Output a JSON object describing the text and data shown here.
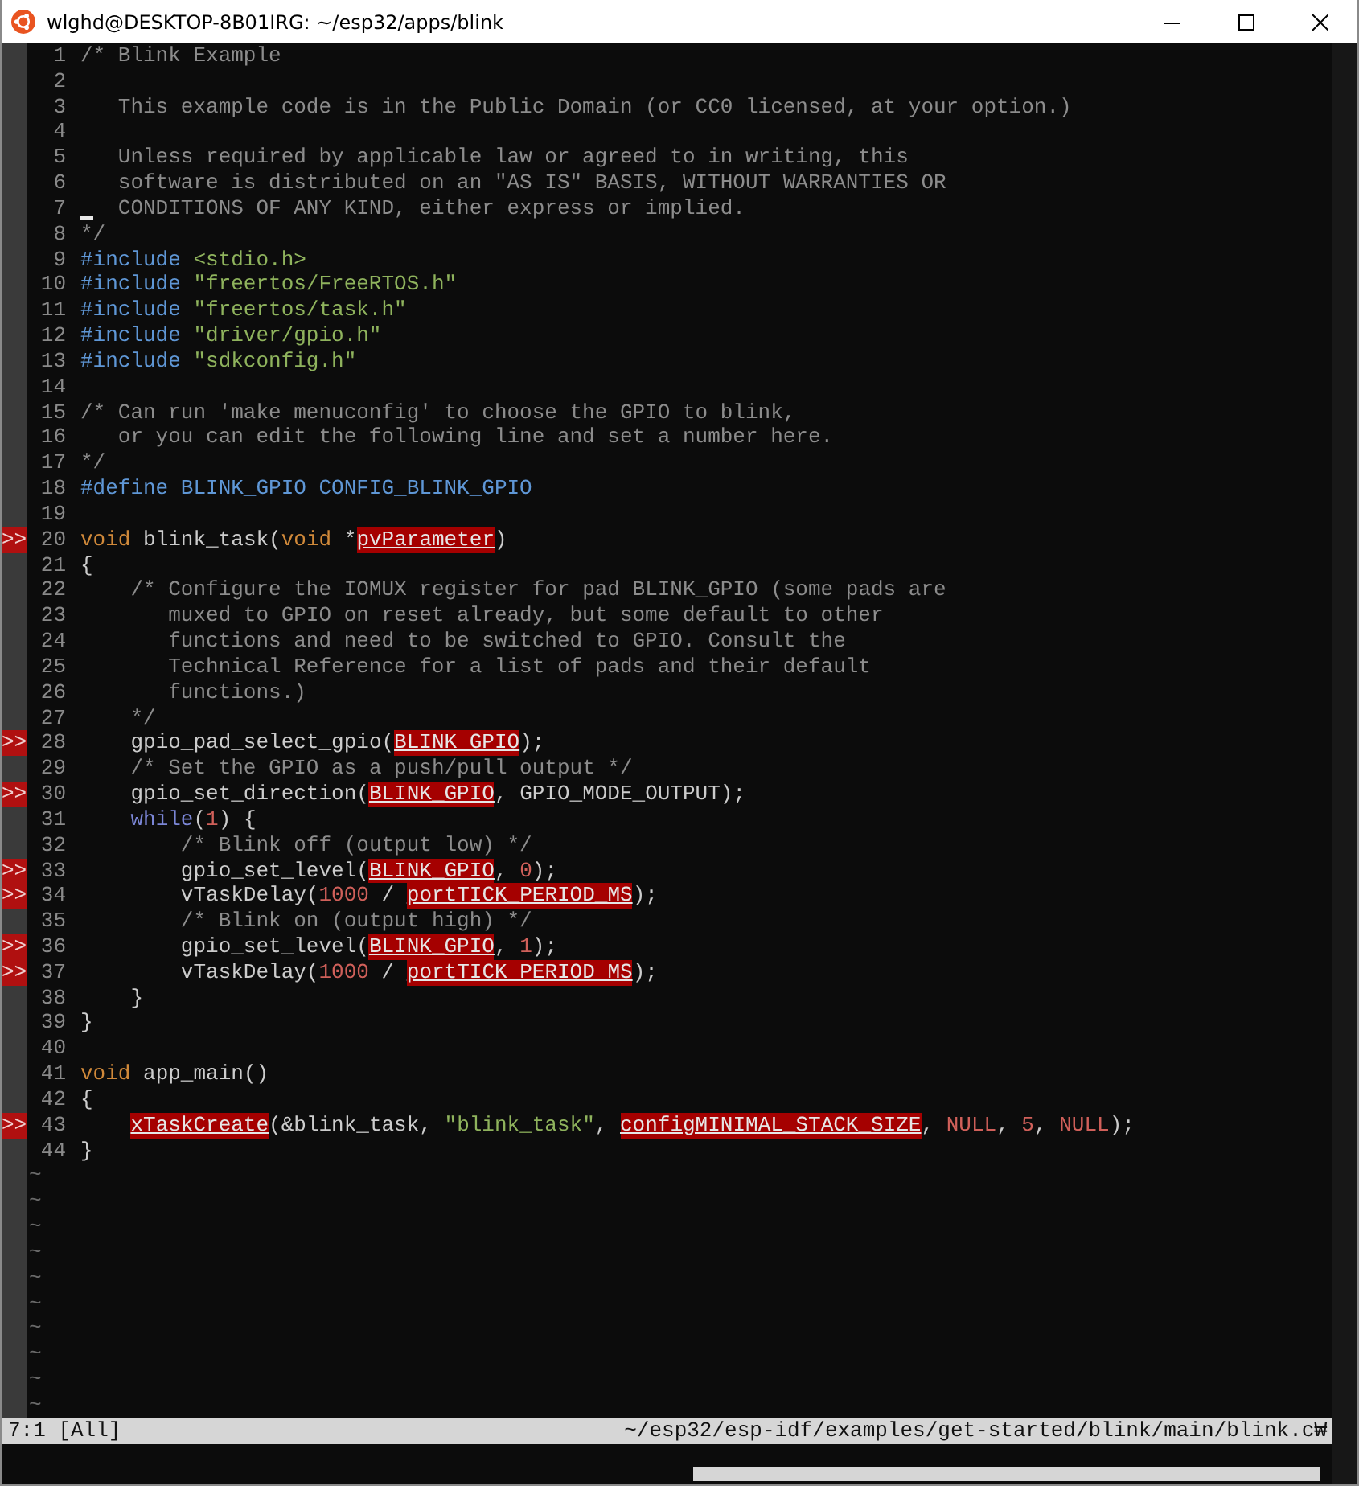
{
  "window": {
    "title": "wlghd@DESKTOP-8B01IRG: ~/esp32/apps/blink"
  },
  "editor": {
    "lines": [
      {
        "number": "1",
        "tokens": [
          {
            "kind": "comment",
            "text": "/* Blink Example"
          }
        ]
      },
      {
        "number": "2"
      },
      {
        "number": "3",
        "tokens": [
          {
            "kind": "comment",
            "text": "   This example code is in the Public Domain (or CC0 licensed, at your option.)"
          }
        ]
      },
      {
        "number": "4"
      },
      {
        "number": "5",
        "tokens": [
          {
            "kind": "comment",
            "text": "   Unless required by applicable law or agreed to in writing, this"
          }
        ]
      },
      {
        "number": "6",
        "tokens": [
          {
            "kind": "comment",
            "text": "   software is distributed on an \"AS IS\" BASIS, WITHOUT WARRANTIES OR"
          }
        ]
      },
      {
        "number": "7",
        "cursor": true,
        "tokens": [
          {
            "kind": "comment",
            "text": "   CONDITIONS OF ANY KIND, either express or implied."
          }
        ]
      },
      {
        "number": "8",
        "tokens": [
          {
            "kind": "comment",
            "text": "*/"
          }
        ]
      },
      {
        "number": "9",
        "tokens": [
          {
            "kind": "preproc",
            "text": "#include "
          },
          {
            "kind": "string",
            "text": "<stdio.h>"
          }
        ]
      },
      {
        "number": "10",
        "tokens": [
          {
            "kind": "preproc",
            "text": "#include "
          },
          {
            "kind": "string",
            "text": "\"freertos/FreeRTOS.h\""
          }
        ]
      },
      {
        "number": "11",
        "tokens": [
          {
            "kind": "preproc",
            "text": "#include "
          },
          {
            "kind": "string",
            "text": "\"freertos/task.h\""
          }
        ]
      },
      {
        "number": "12",
        "tokens": [
          {
            "kind": "preproc",
            "text": "#include "
          },
          {
            "kind": "string",
            "text": "\"driver/gpio.h\""
          }
        ]
      },
      {
        "number": "13",
        "tokens": [
          {
            "kind": "preproc",
            "text": "#include "
          },
          {
            "kind": "string",
            "text": "\"sdkconfig.h\""
          }
        ]
      },
      {
        "number": "14"
      },
      {
        "number": "15",
        "tokens": [
          {
            "kind": "comment",
            "text": "/* Can run 'make menuconfig' to choose the GPIO to blink,"
          }
        ]
      },
      {
        "number": "16",
        "tokens": [
          {
            "kind": "comment",
            "text": "   or you can edit the following line and set a number here."
          }
        ]
      },
      {
        "number": "17",
        "tokens": [
          {
            "kind": "comment",
            "text": "*/"
          }
        ]
      },
      {
        "number": "18",
        "tokens": [
          {
            "kind": "preproc",
            "text": "#define BLINK_GPIO CONFIG_BLINK_GPIO"
          }
        ]
      },
      {
        "number": "19"
      },
      {
        "number": "20",
        "sign": ">>",
        "tokens": [
          {
            "kind": "type",
            "text": "void"
          },
          {
            "kind": "plain",
            "text": " blink_task("
          },
          {
            "kind": "type",
            "text": "void"
          },
          {
            "kind": "plain",
            "text": " *"
          },
          {
            "kind": "error",
            "text": "pvParameter"
          },
          {
            "kind": "plain",
            "text": ")"
          }
        ]
      },
      {
        "number": "21",
        "tokens": [
          {
            "kind": "plain",
            "text": "{"
          }
        ]
      },
      {
        "number": "22",
        "tokens": [
          {
            "kind": "comment",
            "text": "    /* Configure the IOMUX register for pad BLINK_GPIO (some pads are"
          }
        ]
      },
      {
        "number": "23",
        "tokens": [
          {
            "kind": "comment",
            "text": "       muxed to GPIO on reset already, but some default to other"
          }
        ]
      },
      {
        "number": "24",
        "tokens": [
          {
            "kind": "comment",
            "text": "       functions and need to be switched to GPIO. Consult the"
          }
        ]
      },
      {
        "number": "25",
        "tokens": [
          {
            "kind": "comment",
            "text": "       Technical Reference for a list of pads and their default"
          }
        ]
      },
      {
        "number": "26",
        "tokens": [
          {
            "kind": "comment",
            "text": "       functions.)"
          }
        ]
      },
      {
        "number": "27",
        "tokens": [
          {
            "kind": "comment",
            "text": "    */"
          }
        ]
      },
      {
        "number": "28",
        "sign": ">>",
        "tokens": [
          {
            "kind": "plain",
            "text": "    gpio_pad_select_gpio("
          },
          {
            "kind": "error",
            "text": "BLINK_GPIO"
          },
          {
            "kind": "plain",
            "text": ");"
          }
        ]
      },
      {
        "number": "29",
        "tokens": [
          {
            "kind": "comment",
            "text": "    /* Set the GPIO as a push/pull output */"
          }
        ]
      },
      {
        "number": "30",
        "sign": ">>",
        "tokens": [
          {
            "kind": "plain",
            "text": "    gpio_set_direction("
          },
          {
            "kind": "error",
            "text": "BLINK_GPIO"
          },
          {
            "kind": "plain",
            "text": ", GPIO_MODE_OUTPUT);"
          }
        ]
      },
      {
        "number": "31",
        "tokens": [
          {
            "kind": "keyword",
            "text": "    while"
          },
          {
            "kind": "plain",
            "text": "("
          },
          {
            "kind": "number",
            "text": "1"
          },
          {
            "kind": "plain",
            "text": ") {"
          }
        ]
      },
      {
        "number": "32",
        "tokens": [
          {
            "kind": "comment",
            "text": "        /* Blink off (output low) */"
          }
        ]
      },
      {
        "number": "33",
        "sign": ">>",
        "tokens": [
          {
            "kind": "plain",
            "text": "        gpio_set_level("
          },
          {
            "kind": "error",
            "text": "BLINK_GPIO"
          },
          {
            "kind": "plain",
            "text": ", "
          },
          {
            "kind": "number",
            "text": "0"
          },
          {
            "kind": "plain",
            "text": ");"
          }
        ]
      },
      {
        "number": "34",
        "sign": ">>",
        "tokens": [
          {
            "kind": "plain",
            "text": "        vTaskDelay("
          },
          {
            "kind": "number",
            "text": "1000"
          },
          {
            "kind": "plain",
            "text": " / "
          },
          {
            "kind": "error",
            "text": "portTICK_PERIOD_MS"
          },
          {
            "kind": "plain",
            "text": ");"
          }
        ]
      },
      {
        "number": "35",
        "tokens": [
          {
            "kind": "comment",
            "text": "        /* Blink on (output high) */"
          }
        ]
      },
      {
        "number": "36",
        "sign": ">>",
        "tokens": [
          {
            "kind": "plain",
            "text": "        gpio_set_level("
          },
          {
            "kind": "error",
            "text": "BLINK_GPIO"
          },
          {
            "kind": "plain",
            "text": ", "
          },
          {
            "kind": "number",
            "text": "1"
          },
          {
            "kind": "plain",
            "text": ");"
          }
        ]
      },
      {
        "number": "37",
        "sign": ">>",
        "tokens": [
          {
            "kind": "plain",
            "text": "        vTaskDelay("
          },
          {
            "kind": "number",
            "text": "1000"
          },
          {
            "kind": "plain",
            "text": " / "
          },
          {
            "kind": "error",
            "text": "portTICK_PERIOD_MS"
          },
          {
            "kind": "plain",
            "text": ");"
          }
        ]
      },
      {
        "number": "38",
        "tokens": [
          {
            "kind": "plain",
            "text": "    }"
          }
        ]
      },
      {
        "number": "39",
        "tokens": [
          {
            "kind": "plain",
            "text": "}"
          }
        ]
      },
      {
        "number": "40"
      },
      {
        "number": "41",
        "tokens": [
          {
            "kind": "type",
            "text": "void"
          },
          {
            "kind": "plain",
            "text": " app_main()"
          }
        ]
      },
      {
        "number": "42",
        "tokens": [
          {
            "kind": "plain",
            "text": "{"
          }
        ]
      },
      {
        "number": "43",
        "sign": ">>",
        "tokens": [
          {
            "kind": "error",
            "text": "    xTaskCreate"
          },
          {
            "kind": "plain",
            "text": "(&blink_task, "
          },
          {
            "kind": "string",
            "text": "\"blink_task\""
          },
          {
            "kind": "plain",
            "text": ", "
          },
          {
            "kind": "error",
            "text": "configMINIMAL_STACK_SIZE"
          },
          {
            "kind": "plain",
            "text": ", "
          },
          {
            "kind": "number",
            "text": "NULL"
          },
          {
            "kind": "plain",
            "text": ", "
          },
          {
            "kind": "number",
            "text": "5"
          },
          {
            "kind": "plain",
            "text": ", "
          },
          {
            "kind": "number",
            "text": "NULL"
          },
          {
            "kind": "plain",
            "text": ");"
          }
        ]
      },
      {
        "number": "44",
        "tokens": [
          {
            "kind": "plain",
            "text": "}"
          }
        ]
      }
    ],
    "filler_lines": [
      "~",
      "~",
      "~",
      "~",
      "~",
      "~",
      "~",
      "~",
      "~",
      "~"
    ]
  },
  "status_bar": {
    "position": "7:1 [All]",
    "path": "~/esp32/esp-idf/examples/get-started/blink/main/blink.c₩"
  }
}
